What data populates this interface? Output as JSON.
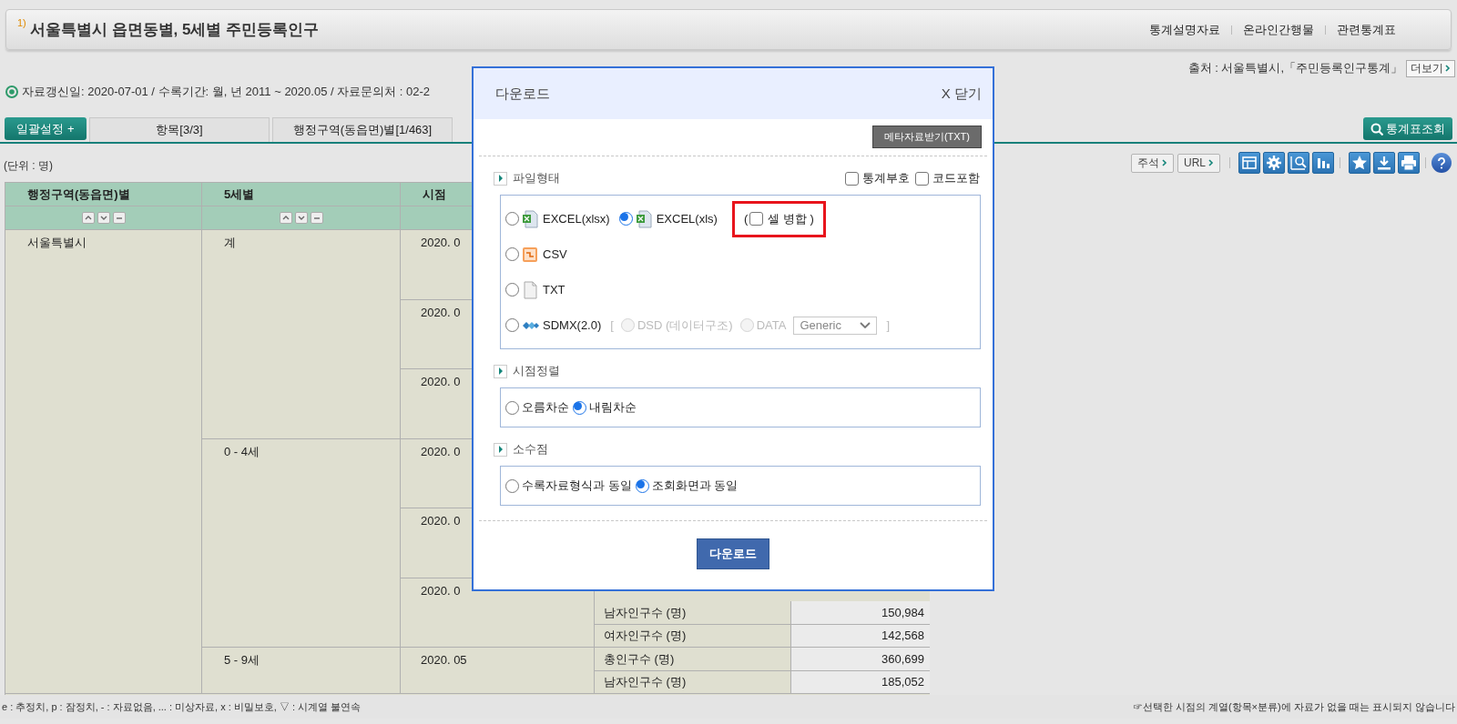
{
  "header": {
    "footnote": "1)",
    "title": "서울특별시 읍면동별, 5세별 주민등록인구",
    "links": [
      "통계설명자료",
      "온라인간행물",
      "관련통계표"
    ]
  },
  "source": {
    "text": "출처 : 서울특별시,「주민등록인구통계」",
    "more_button": "더보기"
  },
  "info": "자료갱신일: 2020-07-01 / 수록기간: 월, 년 2011 ~ 2020.05 / 자료문의처 : 02-2",
  "batch_button": "일괄설정 +",
  "tabs": [
    {
      "label": "항목[3/3]",
      "selected": false
    },
    {
      "label": "행정구역(동읍면)별[1/463]",
      "selected": false
    }
  ],
  "search_button": "통계표조회",
  "unit": "(단위 : 명)",
  "toolbar": {
    "text_buttons": [
      "주석",
      "URL"
    ]
  },
  "table": {
    "columns": [
      {
        "label": "행정구역(동읍면)별",
        "sort_controls": true
      },
      {
        "label": "5세별",
        "sort_controls": true
      },
      {
        "label": "시점"
      }
    ],
    "regions": [
      {
        "label": "서울특별시",
        "ages": [
          {
            "label": "계",
            "periods": [
              {
                "label": "2020. 0",
                "rows": [
                  {
                    "kind": "hidden"
                  },
                  {
                    "kind": "hidden"
                  },
                  {
                    "kind": "hidden"
                  }
                ]
              },
              {
                "label": "2020. 0",
                "rows": [
                  {
                    "kind": "hidden"
                  },
                  {
                    "kind": "hidden"
                  },
                  {
                    "kind": "hidden"
                  }
                ]
              },
              {
                "label": "2020. 0",
                "rows": [
                  {
                    "kind": "hidden"
                  },
                  {
                    "kind": "hidden"
                  },
                  {
                    "kind": "hidden"
                  }
                ]
              }
            ]
          },
          {
            "label": "0 - 4세",
            "periods": [
              {
                "label": "2020. 0",
                "rows": [
                  {
                    "kind": "hidden"
                  },
                  {
                    "kind": "hidden"
                  },
                  {
                    "kind": "hidden"
                  }
                ]
              },
              {
                "label": "2020. 0",
                "rows": [
                  {
                    "kind": "hidden"
                  },
                  {
                    "kind": "hidden"
                  },
                  {
                    "kind": "hidden"
                  }
                ]
              },
              {
                "label": "2020. 0",
                "rows": [
                  {
                    "kind": "hidden"
                  },
                  {
                    "kind": "data",
                    "item": "남자인구수 (명)",
                    "value": "150,984"
                  },
                  {
                    "kind": "data",
                    "item": "여자인구수 (명)",
                    "value": "142,568"
                  }
                ]
              }
            ]
          },
          {
            "label": "5 - 9세",
            "periods": [
              {
                "label": "2020. 05",
                "rows": [
                  {
                    "kind": "data",
                    "item": "총인구수 (명)",
                    "value": "360,699"
                  },
                  {
                    "kind": "data",
                    "item": "남자인구수 (명)",
                    "value": "185,052"
                  }
                ]
              }
            ]
          }
        ]
      }
    ]
  },
  "legend": "e : 추정치, p : 잠정치, - : 자료없음, ... : 미상자료, x : 비밀보호, ▽ : 시계열 불연속",
  "note": "☞선택한 시점의 계열(항목×분류)에 자료가 없을 때는 표시되지 않습니다",
  "dialog": {
    "title": "다운로드",
    "close_button": "X 닫기",
    "meta_button": "메타자료받기(TXT)",
    "file_format": {
      "title": "파일형태",
      "flags": [
        {
          "label": "통계부호",
          "checked": false
        },
        {
          "label": "코드포함",
          "checked": false
        }
      ],
      "lines": [
        [
          {
            "label": "EXCEL(xlsx)",
            "kind": "excel",
            "selected": false
          },
          {
            "label": "EXCEL(xls)",
            "kind": "excel",
            "selected": true,
            "merge": {
              "open": "(",
              "label": "셀 병합 )",
              "checked": false,
              "highlighted": true
            }
          }
        ],
        [
          {
            "label": "CSV",
            "kind": "csv",
            "selected": false
          }
        ],
        [
          {
            "label": "TXT",
            "kind": "txt",
            "selected": false
          }
        ],
        [
          {
            "label": "SDMX(2.0)",
            "kind": "sdmx",
            "selected": false,
            "sdmx": {
              "open": "[",
              "options": [
                {
                  "label": "DSD (데이터구조)",
                  "selected": false,
                  "disabled": true
                },
                {
                  "label": "DATA",
                  "selected": false,
                  "disabled": true
                }
              ],
              "select": "Generic",
              "close": "]"
            }
          }
        ]
      ]
    },
    "sections": [
      {
        "title": "시점정렬",
        "options": [
          {
            "label": "오름차순",
            "selected": false
          },
          {
            "label": "내림차순",
            "selected": true
          }
        ]
      },
      {
        "title": "소수점",
        "options": [
          {
            "label": "수록자료형식과 동일",
            "selected": false
          },
          {
            "label": "조회화면과 동일",
            "selected": true
          }
        ]
      }
    ],
    "download_button": "다운로드"
  }
}
